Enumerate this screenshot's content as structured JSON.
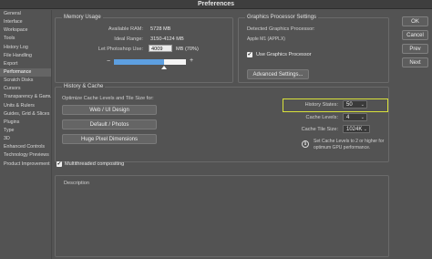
{
  "window": {
    "title": "Preferences"
  },
  "sidebar": {
    "items": [
      {
        "label": "General"
      },
      {
        "label": "Interface"
      },
      {
        "label": "Workspace"
      },
      {
        "label": "Tools"
      },
      {
        "label": "History Log"
      },
      {
        "label": "File Handling"
      },
      {
        "label": "Export"
      },
      {
        "label": "Performance",
        "active": true
      },
      {
        "label": "Scratch Disks"
      },
      {
        "label": "Cursors"
      },
      {
        "label": "Transparency & Gamut"
      },
      {
        "label": "Units & Rulers"
      },
      {
        "label": "Guides, Grid & Slices"
      },
      {
        "label": "Plugins"
      },
      {
        "label": "Type"
      },
      {
        "label": "3D"
      },
      {
        "label": "Enhanced Controls"
      },
      {
        "label": "Technology Previews"
      },
      {
        "label": "Product Improvement"
      }
    ]
  },
  "memory": {
    "heading": "Memory Usage",
    "available_label": "Available RAM:",
    "available_value": "5728 MB",
    "ideal_label": "Ideal Range:",
    "ideal_value": "3150-4124 MB",
    "let_label": "Let Photoshop Use:",
    "let_value": "4009",
    "let_suffix": "MB (70%)",
    "minus": "−",
    "plus": "+",
    "usage_fraction": 0.7
  },
  "gpu": {
    "heading": "Graphics Processor Settings",
    "detected_label": "Detected Graphics Processor:",
    "detected_value": "Apple M1 (APPLX)",
    "use_gpu_label": "Use Graphics Processor",
    "use_gpu_checked": "✓",
    "advanced_button": "Advanced Settings..."
  },
  "history_cache": {
    "heading": "History & Cache",
    "optimize_label": "Optimize Cache Levels and Tile Size for:",
    "buttons": {
      "web_ui": "Web / UI Design",
      "default_photos": "Default / Photos",
      "huge_pixel": "Huge Pixel Dimensions"
    },
    "history_states_label": "History States:",
    "history_states_value": "50",
    "cache_levels_label": "Cache Levels:",
    "cache_levels_value": "4",
    "tile_size_label": "Cache Tile Size:",
    "tile_size_value": "1024K",
    "info_text_line1": "Set Cache Levels to 2 or higher for",
    "info_text_line2": "optimum GPU performance.",
    "chevron": "⌄",
    "info_glyph": "i"
  },
  "compositing": {
    "label": "Multithreaded compositing",
    "checked": "✓"
  },
  "description": {
    "heading": "Description"
  },
  "actions": {
    "ok": "OK",
    "cancel": "Cancel",
    "prev": "Prev",
    "next": "Next"
  },
  "colors": {
    "highlight": "#d8e23a",
    "slider_fill": "#5d9fe0",
    "panel_bg": "#535353"
  }
}
